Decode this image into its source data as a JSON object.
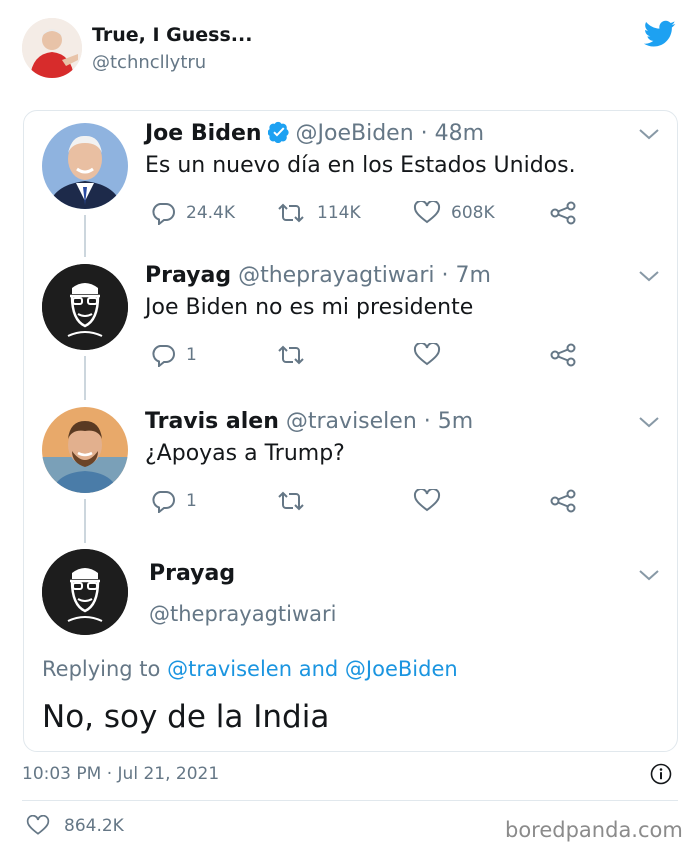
{
  "outer": {
    "name": "True, I Guess...",
    "handle": "@tchncllytru",
    "brand_icon": "twitter-bird-icon",
    "brand_color": "#1da1f2"
  },
  "thread": [
    {
      "name": "Joe Biden",
      "verified": true,
      "meta": "@JoeBiden · 48m",
      "text": "Es un nuevo día en los Estados Unidos.",
      "reply_count": "24.4K",
      "retweet_count": "114K",
      "like_count": "608K"
    },
    {
      "name": "Prayag",
      "verified": false,
      "meta": "@theprayagtiwari · 7m",
      "text": "Joe Biden no es mi presidente",
      "reply_count": "1",
      "retweet_count": "",
      "like_count": ""
    },
    {
      "name": "Travis alen",
      "verified": false,
      "meta": "@traviselen · 5m",
      "text": "¿Apoyas a Trump?",
      "reply_count": "1",
      "retweet_count": "",
      "like_count": ""
    }
  ],
  "main_tweet": {
    "name": "Prayag",
    "handle": "@theprayagtiwari",
    "replying_prefix": "Replying to",
    "replying_mention_1": "@traviselen",
    "replying_and": "and",
    "replying_mention_2": "@JoeBiden",
    "text": "No, soy de la India"
  },
  "footer": {
    "timestamp": "10:03 PM · Jul 21, 2021",
    "like_count": "864.2K",
    "watermark": "boredpanda.com"
  },
  "colors": {
    "text": "#14171a",
    "secondary": "#657786",
    "link": "#1b95e0",
    "border": "#e1e8ed",
    "verified": "#1da1f2"
  }
}
